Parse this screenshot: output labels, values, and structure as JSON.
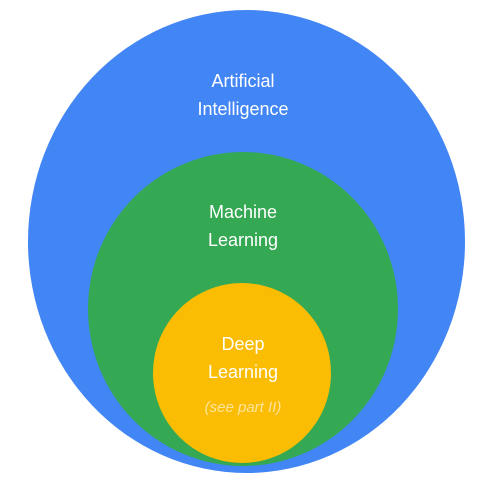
{
  "colors": {
    "ai": "#4285f4",
    "ml": "#34a853",
    "dl": "#fbbc04"
  },
  "circles": {
    "ai": {
      "line1": "Artificial",
      "line2": "Intelligence"
    },
    "ml": {
      "line1": "Machine",
      "line2": "Learning"
    },
    "dl": {
      "line1": "Deep",
      "line2": "Learning",
      "note": "(see part II)"
    }
  }
}
